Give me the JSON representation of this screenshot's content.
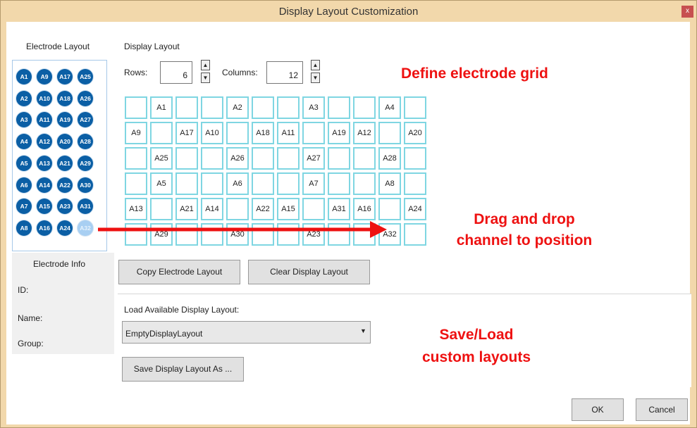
{
  "window": {
    "title": "Display Layout Customization",
    "close_label": "x"
  },
  "electrode_layout": {
    "heading": "Electrode Layout",
    "columns": [
      [
        "A1",
        "A2",
        "A3",
        "A4",
        "A5",
        "A6",
        "A7",
        "A8"
      ],
      [
        "A9",
        "A10",
        "A11",
        "A12",
        "A13",
        "A14",
        "A15",
        "A16"
      ],
      [
        "A17",
        "A18",
        "A19",
        "A20",
        "A21",
        "A22",
        "A23",
        "A24"
      ],
      [
        "A25",
        "A26",
        "A27",
        "A28",
        "A29",
        "A30",
        "A31",
        "A32"
      ]
    ],
    "selected": "A32"
  },
  "electrode_info": {
    "heading": "Electrode Info",
    "id_label": "ID:",
    "name_label": "Name:",
    "group_label": "Group:"
  },
  "display_layout": {
    "heading": "Display Layout",
    "rows_label": "Rows:",
    "rows_value": "6",
    "columns_label": "Columns:",
    "columns_value": "12",
    "grid": [
      [
        "",
        "A1",
        "",
        "",
        "A2",
        "",
        "",
        "A3",
        "",
        "",
        "A4",
        ""
      ],
      [
        "A9",
        "",
        "A17",
        "A10",
        "",
        "A18",
        "A11",
        "",
        "A19",
        "A12",
        "",
        "A20"
      ],
      [
        "",
        "A25",
        "",
        "",
        "A26",
        "",
        "",
        "A27",
        "",
        "",
        "A28",
        ""
      ],
      [
        "",
        "A5",
        "",
        "",
        "A6",
        "",
        "",
        "A7",
        "",
        "",
        "A8",
        ""
      ],
      [
        "A13",
        "",
        "A21",
        "A14",
        "",
        "A22",
        "A15",
        "",
        "A31",
        "A16",
        "",
        "A24"
      ],
      [
        "",
        "A29",
        "",
        "",
        "A30",
        "",
        "",
        "A23",
        "",
        "",
        "A32",
        ""
      ]
    ]
  },
  "actions": {
    "copy_label": "Copy Electrode Layout",
    "clear_label": "Clear Display Layout",
    "load_label": "Load Available Display Layout:",
    "selected_layout": "EmptyDisplayLayout",
    "save_as_label": "Save Display Layout As ...",
    "ok_label": "OK",
    "cancel_label": "Cancel"
  },
  "annotations": {
    "define_grid": "Define electrode grid",
    "drag_drop_line1": "Drag and drop",
    "drag_drop_line2": "channel to position",
    "save_load_line1": "Save/Load",
    "save_load_line2": "custom layouts",
    "color": "#ee1111"
  },
  "colors": {
    "titlebar": "#f2d8ab",
    "electrode": "#0b5fa5",
    "electrode_selected": "#a8cff2",
    "grid_border": "#7fd6e2"
  }
}
